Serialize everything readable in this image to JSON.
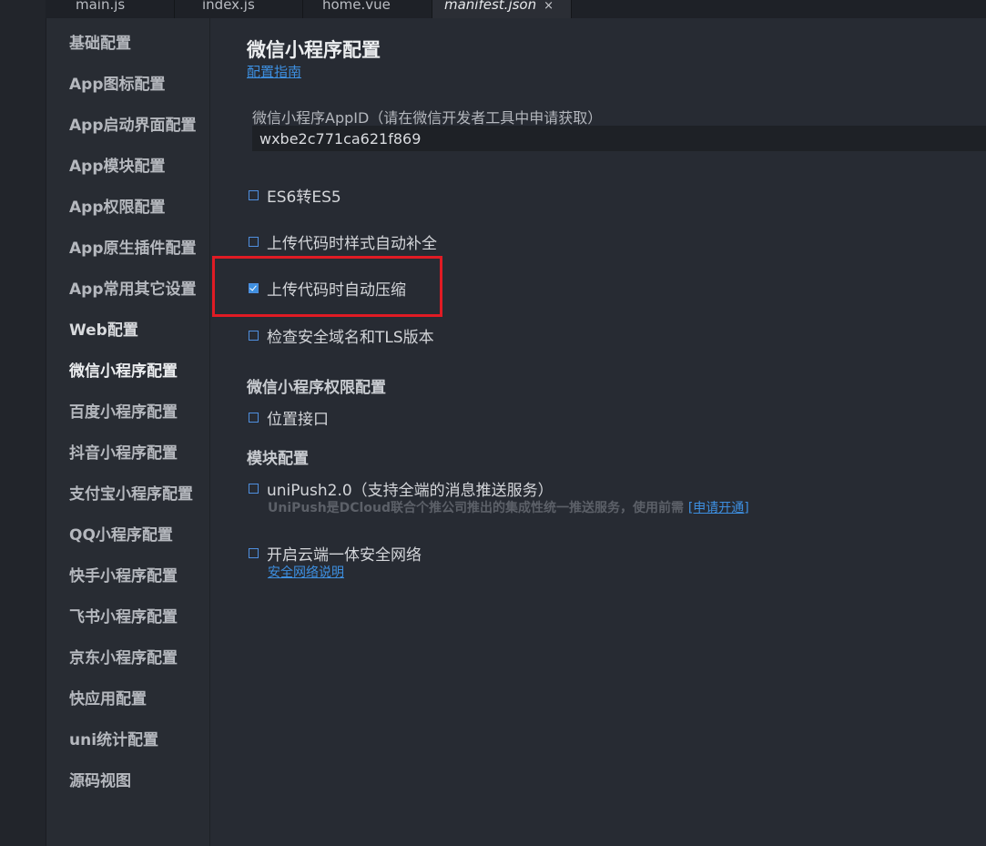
{
  "tabs": [
    {
      "label": "main.js"
    },
    {
      "label": "index.js"
    },
    {
      "label": "home.vue"
    },
    {
      "label": "manifest.json",
      "close": "×"
    }
  ],
  "sidebar": {
    "items": [
      {
        "label": "基础配置"
      },
      {
        "label": "App图标配置"
      },
      {
        "label": "App启动界面配置"
      },
      {
        "label": "App模块配置"
      },
      {
        "label": "App权限配置"
      },
      {
        "label": "App原生插件配置"
      },
      {
        "label": "App常用其它设置"
      },
      {
        "label": "Web配置"
      },
      {
        "label": "微信小程序配置"
      },
      {
        "label": "百度小程序配置"
      },
      {
        "label": "抖音小程序配置"
      },
      {
        "label": "支付宝小程序配置"
      },
      {
        "label": "QQ小程序配置"
      },
      {
        "label": "快手小程序配置"
      },
      {
        "label": "飞书小程序配置"
      },
      {
        "label": "京东小程序配置"
      },
      {
        "label": "快应用配置"
      },
      {
        "label": "uni统计配置"
      },
      {
        "label": "源码视图"
      }
    ]
  },
  "main": {
    "title": "微信小程序配置",
    "guide_link": "配置指南",
    "appid_label": "微信小程序AppID（请在微信开发者工具中申请获取）",
    "appid_value": "wxbe2c771ca621f869",
    "options": [
      {
        "label": "ES6转ES5",
        "checked": false
      },
      {
        "label": "上传代码时样式自动补全",
        "checked": false
      },
      {
        "label": "上传代码时自动压缩",
        "checked": true
      },
      {
        "label": "检查安全域名和TLS版本",
        "checked": false
      }
    ],
    "permissions_title": "微信小程序权限配置",
    "permissions": [
      {
        "label": "位置接口",
        "checked": false
      }
    ],
    "modules_title": "模块配置",
    "unipush_label": "uniPush2.0（支持全端的消息推送服务）",
    "unipush_note": "UniPush是DCloud联合个推公司推出的集成性统一推送服务，使用前需",
    "unipush_link": "[申请开通]",
    "secure_network_label": "开启云端一体安全网络",
    "secure_network_link": "安全网络说明"
  },
  "colors": {
    "accent": "#3d8fe0",
    "highlight": "#e01b24",
    "background": "#272b33"
  }
}
